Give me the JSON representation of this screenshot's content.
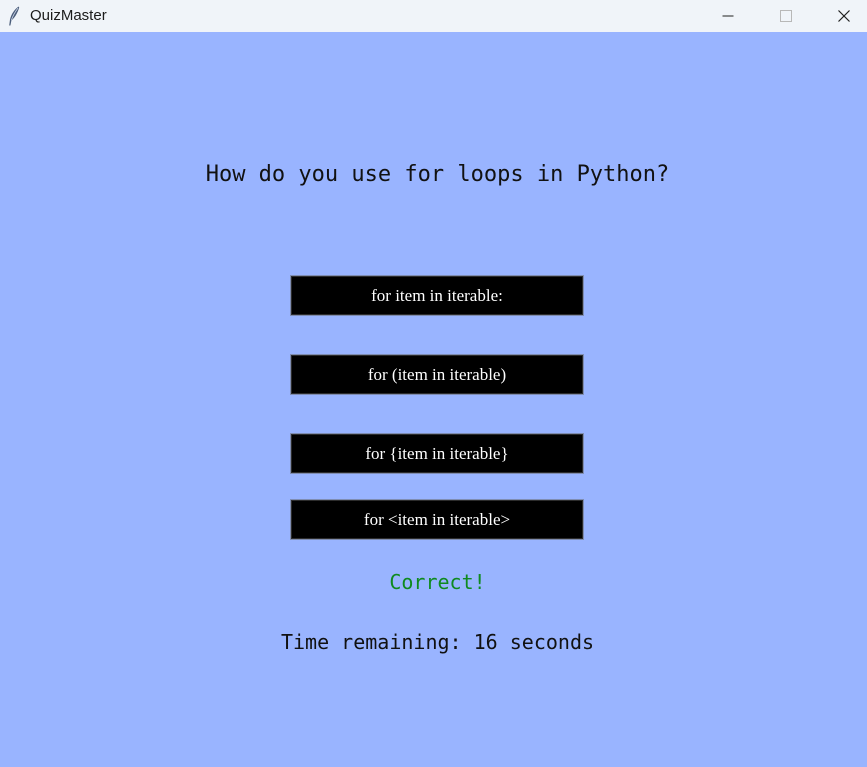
{
  "window": {
    "title": "QuizMaster",
    "icons": {
      "app": "feather-icon",
      "minimize": "minimize-icon",
      "maximize": "maximize-icon",
      "close": "close-icon"
    }
  },
  "quiz": {
    "question": "How do you use for loops in Python?",
    "answers": [
      "for item in iterable:",
      "for (item in iterable)",
      "for {item in iterable}",
      "for <item in iterable>"
    ],
    "feedback": "Correct!",
    "timer_text": "Time remaining: 16 seconds"
  },
  "colors": {
    "background": "#99b4ff",
    "titlebar": "#f0f4f9",
    "button_bg": "#000000",
    "button_text": "#ffffff",
    "feedback": "#0f8a20",
    "text": "#111111"
  }
}
